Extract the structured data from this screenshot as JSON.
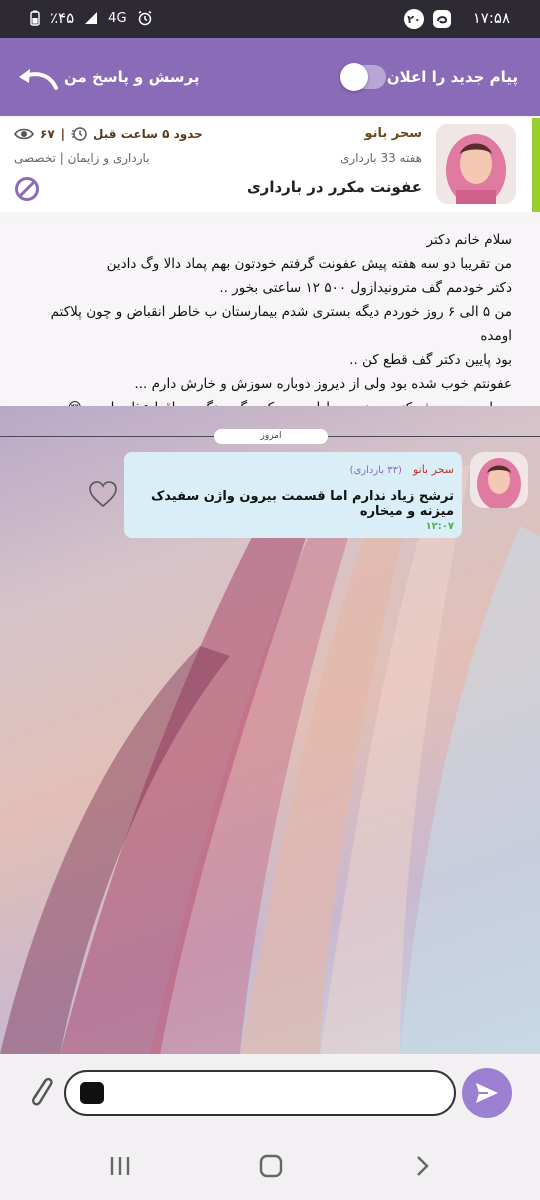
{
  "status_bar": {
    "time": "۱۷:۵۸",
    "notification_count": "۲۰",
    "battery": "٪۴۵",
    "network": "4G"
  },
  "header": {
    "notify_label": "پیام جدید را اعلان کن",
    "qa_label": "پرسش و پاسخ من",
    "toggle_on": false,
    "accent_color": "#8a6bb8"
  },
  "question": {
    "author_name": "سحر بانو",
    "author_week": "هفته 33 بارداری",
    "title": "عفونت مکرر در بارداری",
    "time_ago": "حدود ۵ ساعت قبل",
    "views": "۶۷",
    "category": "بارداری و زایمان | تخصصی",
    "body_lines": [
      "سلام خانم دکتر",
      "من تقریبا دو سه هفته پیش عفونت گرفتم خودتون بهم پماد دالا وگ دادین",
      "دکتر خودمم گف مترونیدازول ۵۰۰ ۱۲ ساعتی بخور ..",
      "من ۵ الی ۶ روز خوردم دیگه بستری شدم بیمارستان ب خاطر انقباض و چون پلاکتم اومده",
      "بود پایین دکتر گف قطع کن ..",
      "عفونتم خوب شده بود ولی از دیروز دوباره سوزش و خارش دارم ...",
      "چ دارویی مصرف کنم و چند روز ادامه بدم ک دیگه برنگرده واقعا عذاب اوره .😔"
    ]
  },
  "chat": {
    "date_label": "امروز",
    "messages": [
      {
        "sender": "سحر بانو",
        "week": "(۳۳ بارداری)",
        "text": "ترشح زیاد ندارم اما قسمت بیرون واژن سفیدک میزنه و میخاره",
        "time": "۱۲:۰۷"
      }
    ]
  },
  "composer": {
    "placeholder": ""
  },
  "icons": {
    "back": "back-arrow-icon",
    "views": "eye-icon",
    "time": "clock-icon",
    "block": "block-icon",
    "heart": "heart-icon",
    "attach": "paperclip-icon",
    "send": "send-icon",
    "emoji": "emoji-icon"
  }
}
